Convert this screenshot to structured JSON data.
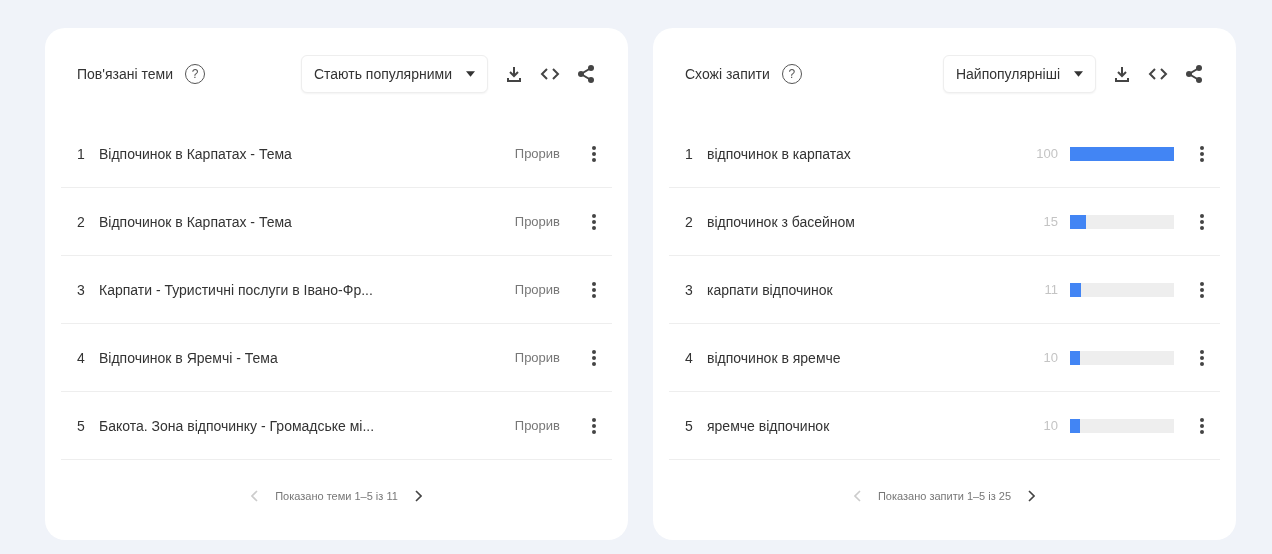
{
  "panels": [
    {
      "title": "Пов'язані теми",
      "help": "?",
      "sort": "Стають популярними",
      "rows": [
        {
          "rank": "1",
          "label": "Відпочинок в Карпатах - Тема",
          "kind": "text",
          "value": "Прорив"
        },
        {
          "rank": "2",
          "label": "Відпочинок в Карпатах - Тема",
          "kind": "text",
          "value": "Прорив"
        },
        {
          "rank": "3",
          "label": "Карпати - Туристичні послуги в Івано-Фр...",
          "kind": "text",
          "value": "Прорив"
        },
        {
          "rank": "4",
          "label": "Відпочинок в Яремчі - Тема",
          "kind": "text",
          "value": "Прорив"
        },
        {
          "rank": "5",
          "label": "Бакота. Зона відпочинку - Громадське мі...",
          "kind": "text",
          "value": "Прорив"
        }
      ],
      "pager": {
        "text": "Показано теми 1–5 із 11",
        "prev_disabled": true,
        "next_disabled": false
      }
    },
    {
      "title": "Схожі запити",
      "help": "?",
      "sort": "Найпопулярніші",
      "rows": [
        {
          "rank": "1",
          "label": "відпочинок в карпатах",
          "kind": "bar",
          "value": "100",
          "level": 1.0
        },
        {
          "rank": "2",
          "label": "відпочинок з басейном",
          "kind": "bar",
          "value": "15",
          "level": 0.15
        },
        {
          "rank": "3",
          "label": "карпати відпочинок",
          "kind": "bar",
          "value": "11",
          "level": 0.11
        },
        {
          "rank": "4",
          "label": "відпочинок в яремче",
          "kind": "bar",
          "value": "10",
          "level": 0.1
        },
        {
          "rank": "5",
          "label": "яремче відпочинок",
          "kind": "bar",
          "value": "10",
          "level": 0.1
        }
      ],
      "pager": {
        "text": "Показано запити 1–5 із 25",
        "prev_disabled": true,
        "next_disabled": false
      }
    }
  ]
}
